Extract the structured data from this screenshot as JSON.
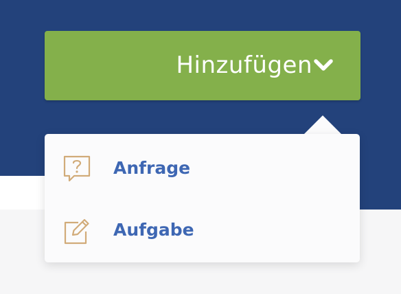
{
  "header": {
    "add_button": {
      "label": "Hinzufügen",
      "icon": "chevron-down-icon",
      "color": "#84b04b"
    },
    "background_color": "#23427b"
  },
  "dropdown": {
    "items": [
      {
        "label": "Anfrage",
        "icon": "question-bubble-icon"
      },
      {
        "label": "Aufgabe",
        "icon": "edit-pencil-icon"
      }
    ],
    "label_color": "#3e67b3",
    "icon_color": "#d1ab79"
  }
}
